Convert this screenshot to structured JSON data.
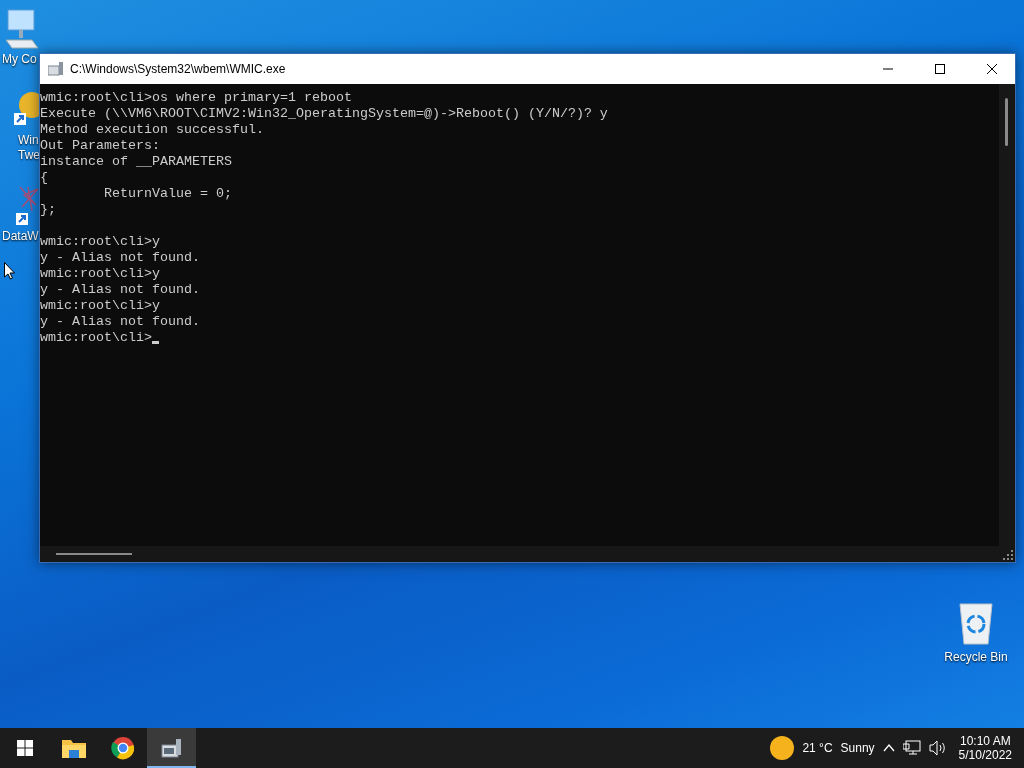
{
  "desktop_icons": [
    {
      "kind": "computer",
      "lines": [
        "My Co"
      ]
    },
    {
      "kind": "shortcut-sun",
      "lines": [
        "Win",
        "Twe"
      ]
    },
    {
      "kind": "shortcut-graph",
      "lines": [
        "DataW"
      ]
    }
  ],
  "recycle_bin": {
    "label": "Recycle Bin"
  },
  "window": {
    "title": "C:\\Windows\\System32\\wbem\\WMIC.exe",
    "lines": [
      {
        "kind": "text",
        "text": "wmic:root\\cli>os where primary=1 reboot"
      },
      {
        "kind": "text",
        "text": "Execute (\\\\VM6\\ROOT\\CIMV2:Win32_OperatingSystem=@)->Reboot() (Y/N/?)? y"
      },
      {
        "kind": "text",
        "text": "Method execution successful."
      },
      {
        "kind": "text",
        "text": "Out Parameters:"
      },
      {
        "kind": "text",
        "text": "instance of __PARAMETERS"
      },
      {
        "kind": "text",
        "text": "{"
      },
      {
        "kind": "text",
        "text": "        ReturnValue = 0;"
      },
      {
        "kind": "text",
        "text": "};"
      },
      {
        "kind": "blank"
      },
      {
        "kind": "text",
        "text": "wmic:root\\cli>y"
      },
      {
        "kind": "text",
        "text": "y - Alias not found."
      },
      {
        "kind": "text",
        "text": "wmic:root\\cli>y"
      },
      {
        "kind": "text",
        "text": "y - Alias not found."
      },
      {
        "kind": "text",
        "text": "wmic:root\\cli>y"
      },
      {
        "kind": "text",
        "text": "y - Alias not found."
      },
      {
        "kind": "prompt",
        "text": "wmic:root\\cli>"
      }
    ]
  },
  "taskbar": {
    "apps": [
      {
        "kind": "explorer",
        "selected": false
      },
      {
        "kind": "browser",
        "selected": false
      },
      {
        "kind": "console",
        "selected": true
      }
    ],
    "temperature": "21 °C",
    "condition": "Sunny",
    "time": "10:10 AM",
    "date": "5/10/2022"
  }
}
